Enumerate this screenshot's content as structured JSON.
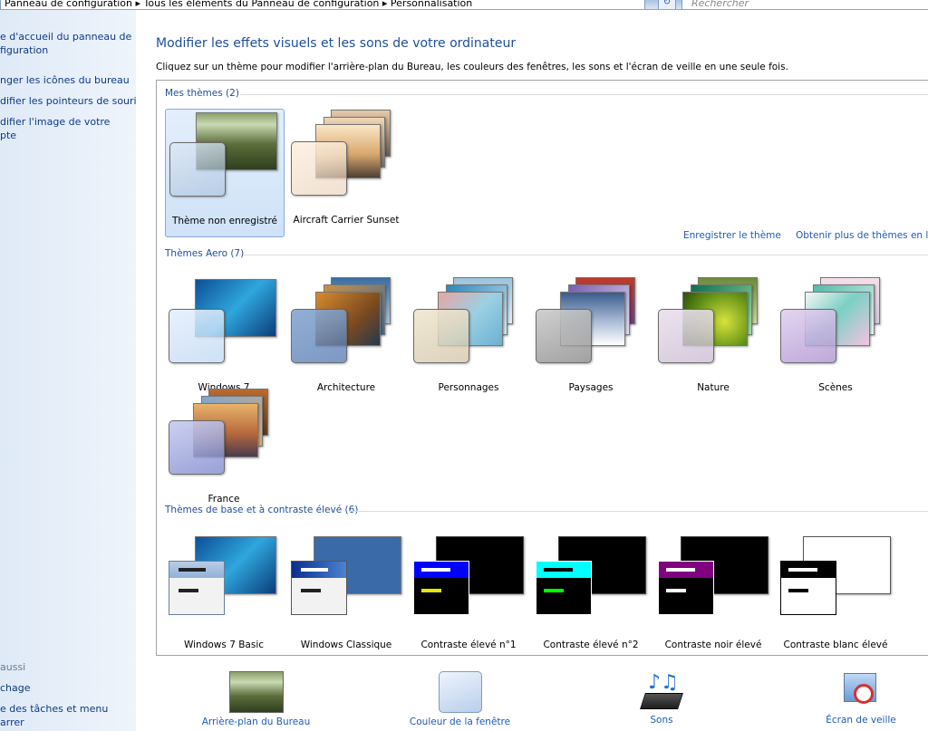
{
  "address": {
    "crumbs": "Panneau de configuration  ▸  Tous les éléments du Panneau de configuration  ▸  Personnalisation",
    "search_placeholder": "Rechercher"
  },
  "left": {
    "links": [
      "e d'accueil du panneau de\nfiguration",
      "nger les icônes du bureau",
      "difier les pointeurs de souris",
      "difier l'image de votre\npte"
    ],
    "see_also_header": "aussi",
    "see_also": [
      "chage",
      "e des tâches et menu\narrer"
    ]
  },
  "main": {
    "title": "Modifier les effets visuels et les sons de votre ordinateur",
    "description": "Cliquez sur un thème pour modifier l'arrière-plan du Bureau, les couleurs des fenêtres, les sons et l'écran de veille en une seule fois.",
    "my_themes": {
      "header": "Mes thèmes (2)",
      "items": [
        "Thème non enregistré",
        "Aircraft Carrier Sunset"
      ]
    },
    "save_theme": "Enregistrer le thème",
    "more_themes": "Obtenir plus de thèmes en li",
    "aero": {
      "header": "Thèmes Aero (7)",
      "items": [
        "Windows 7",
        "Architecture",
        "Personnages",
        "Paysages",
        "Nature",
        "Scènes",
        "France"
      ]
    },
    "basic": {
      "header": "Thèmes de base et à contraste élevé (6)",
      "items": [
        "Windows 7 Basic",
        "Windows Classique",
        "Contraste élevé n°1",
        "Contraste élevé n°2",
        "Contraste noir élevé",
        "Contraste blanc élevé"
      ]
    }
  },
  "bottom": [
    "Arrière-plan du Bureau",
    "Couleur de la fenêtre",
    "Sons",
    "Écran de veille"
  ],
  "colors": {
    "accent": "#1e4e9b",
    "link": "#1e5bb5",
    "selected_bg": "#d6e6f9"
  }
}
